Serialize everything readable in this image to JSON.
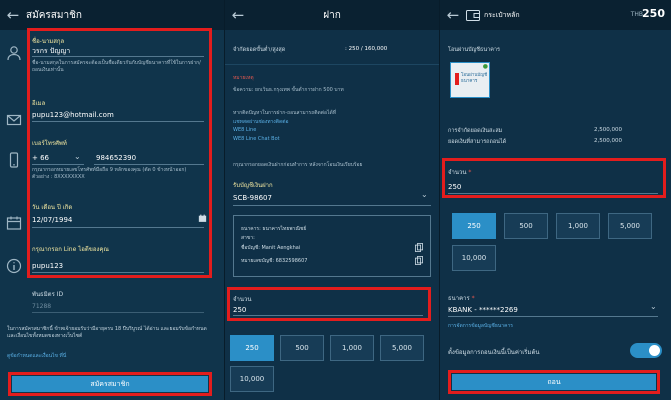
{
  "register": {
    "title": "สมัครสมาชิก",
    "name_label": "ชื่อ-นามสกุล",
    "name_value": "วรกร ปัญญา",
    "name_hint": "ชื่อ-นามสกุลในการสมัครจะต้องเป็นชื่อเดียวกันกับบัญชีธนาคารที่ใช้ในการฝาก/ถอนเงินเท่านั้น",
    "email_label": "อีเมล",
    "email_value": "pupu123@hotmail.com",
    "phone_label": "เบอร์โทรศัพท์",
    "phone_code": "+ 66",
    "phone_value": "984652390",
    "phone_hint": "กรุณากรอกหมายเลขโทรศัพท์มือถือ 9 หลักของคุณ (ตัด 0 ข้างหน้าออก) ตัวอย่าง : 8XXXXXXXX",
    "dob_label": "วัน เดือน ปี เกิด",
    "dob_value": "12/07/1994",
    "line_label": "กรุณากรอก Line ไอดีของคุณ",
    "line_value": "pupu123",
    "partner_label": "พันธมิตร ID",
    "partner_value": "71288",
    "terms_text": "ในการสมัครสมาชิกนี้ ข้าพเจ้ายอมรับว่ามีอายุครบ 18 ปีบริบูรณ์ ได้อ่าน และยอมรับข้อกำหนดและเงื่อนไขทั้งหมดของทางเว็บไซต์",
    "terms_link": "ดูข้อกำหนดและเงื่อนไข ที่นี่",
    "submit_label": "สมัครสมาชิก"
  },
  "deposit": {
    "title": "ฝาก",
    "minmax_label": "จำกัดยอดขั้นต่ำ/สูงสุด",
    "minmax_value": ": 250 / 160,000",
    "notice_title": "หมายเหตุ",
    "notice_1": "ข้อความ: ยกเว้นธ.กรุงเทพ ขั้นต่ำการฝาก 500 บาท",
    "notice_2": "หากติดปัญหาในการฝาก-ถอนสามารถติดต่อได้ที่",
    "contact_1": "แชทสดผ่านช่องทางติดต่อ",
    "contact_2": "WE8 Line",
    "contact_3": "WE8 Line Chat Bot",
    "notice_3": "กรุณากรอกยอดเงินฝากก่อนทำการ หลังจากโอนเงินเรียบร้อย",
    "receive_label": "รับบัญชีเงินฝาก",
    "receive_value": "SCB-98607",
    "bank_line": "ธนาคาร: ธนาคารไทยพาณิชย์",
    "branch_line": "สาขา:",
    "acct_name_line": "ชื่อบัญชี: Manit Aengkhai",
    "acct_no_line": "หมายเลขบัญชี: 6832598607",
    "amount_label": "จำนวน",
    "amount_value": "250",
    "quick": [
      "250",
      "500",
      "1,000",
      "5,000",
      "10,000"
    ]
  },
  "withdraw": {
    "title": "กระเป๋าหลัก",
    "balance_currency": "THB",
    "balance_value": "250",
    "transfer_label": "โอนผ่านบัญชีธนาคาร",
    "bank_tile_label": "โอนผ่านบัญชีธนาคาร",
    "row1_label": "การจำกัดยอดเงินสะสม",
    "row1_value": "2,500,000",
    "row2_label": "ยอดเงินที่สามารถถอนได้",
    "row2_value": "2,500,000",
    "amount_label": "จำนวน",
    "amount_value": "250",
    "quick": [
      "250",
      "500",
      "1,000",
      "5,000",
      "10,000"
    ],
    "bank_label": "ธนาคาร",
    "bank_value": "KBANK - ******2269",
    "bank_link": "การจัดการข้อมูลบัญชีธนาคาร",
    "toggle_label": "ตั้งข้อมูลการถอนเงินนี้เป็นค่าเริ่มต้น",
    "toggle_on": true,
    "submit_label": "ถอน"
  }
}
